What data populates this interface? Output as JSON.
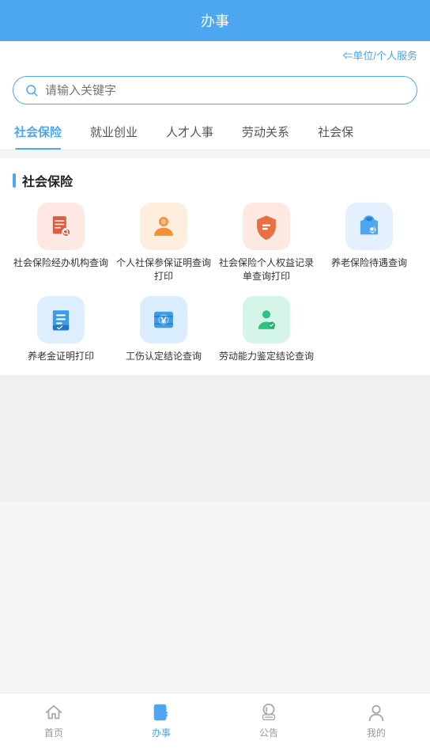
{
  "header": {
    "title": "办事"
  },
  "service_link": {
    "icon": "⇐",
    "text": "⇐单位/个人服务"
  },
  "search": {
    "placeholder": "请输入关键字"
  },
  "tabs": [
    {
      "label": "社会保险",
      "active": true
    },
    {
      "label": "就业创业",
      "active": false
    },
    {
      "label": "人才人事",
      "active": false
    },
    {
      "label": "劳动关系",
      "active": false
    },
    {
      "label": "社会保",
      "active": false
    }
  ],
  "section": {
    "title": "社会保险",
    "grid_items": [
      {
        "id": "item1",
        "label": "社会保险经办机构查询",
        "icon_color": "#fee8e4",
        "icon_type": "search-doc-red"
      },
      {
        "id": "item2",
        "label": "个人社保参保证明查询打印",
        "icon_color": "#fdeede",
        "icon_type": "person-orange"
      },
      {
        "id": "item3",
        "label": "社会保险个人权益记录单查询打印",
        "icon_color": "#fde8e2",
        "icon_type": "shield-orange"
      },
      {
        "id": "item4",
        "label": "养老保险待遇查询",
        "icon_color": "#e4f0fd",
        "icon_type": "bag-blue"
      },
      {
        "id": "item5",
        "label": "养老金证明打印",
        "icon_color": "#ddeeff",
        "icon_type": "doc-blue"
      },
      {
        "id": "item6",
        "label": "工伤认定结论查询",
        "icon_color": "#daeeff",
        "icon_type": "money-blue"
      },
      {
        "id": "item7",
        "label": "劳动能力鉴定结论查询",
        "icon_color": "#d4f5e8",
        "icon_type": "person-green"
      }
    ]
  },
  "bottom_nav": [
    {
      "label": "首页",
      "icon": "home",
      "active": false
    },
    {
      "label": "办事",
      "icon": "edit",
      "active": true
    },
    {
      "label": "公告",
      "icon": "notice",
      "active": false
    },
    {
      "label": "我的",
      "icon": "user",
      "active": false
    }
  ]
}
